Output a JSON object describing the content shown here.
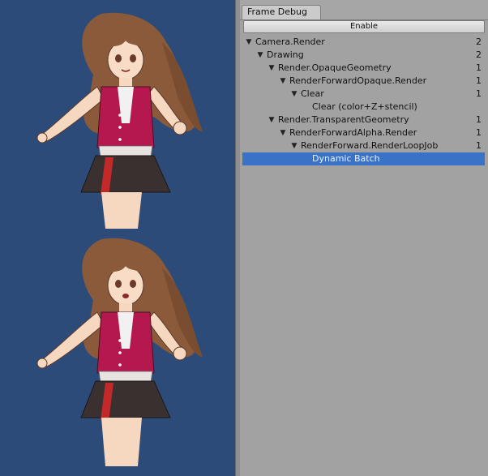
{
  "panel": {
    "tab_title": "Frame Debug",
    "enable_label": "Enable"
  },
  "tree": [
    {
      "label": "Camera.Render",
      "count": "2",
      "depth": 0,
      "expandable": true
    },
    {
      "label": "Drawing",
      "count": "2",
      "depth": 1,
      "expandable": true
    },
    {
      "label": "Render.OpaqueGeometry",
      "count": "1",
      "depth": 2,
      "expandable": true
    },
    {
      "label": "RenderForwardOpaque.Render",
      "count": "1",
      "depth": 3,
      "expandable": true
    },
    {
      "label": "Clear",
      "count": "1",
      "depth": 4,
      "expandable": true
    },
    {
      "label": "Clear (color+Z+stencil)",
      "count": "",
      "depth": 5,
      "expandable": false
    },
    {
      "label": "Render.TransparentGeometry",
      "count": "1",
      "depth": 2,
      "expandable": true
    },
    {
      "label": "RenderForwardAlpha.Render",
      "count": "1",
      "depth": 3,
      "expandable": true
    },
    {
      "label": "RenderForward.RenderLoopJob",
      "count": "1",
      "depth": 4,
      "expandable": true
    },
    {
      "label": "Dynamic Batch",
      "count": "",
      "depth": 5,
      "expandable": false,
      "selected": true
    }
  ],
  "icons": {
    "expand": "triangle-down-icon"
  },
  "colors": {
    "game_background": "#2c4b79",
    "panel_background": "#a2a2a2",
    "selection": "#3a72c6"
  }
}
